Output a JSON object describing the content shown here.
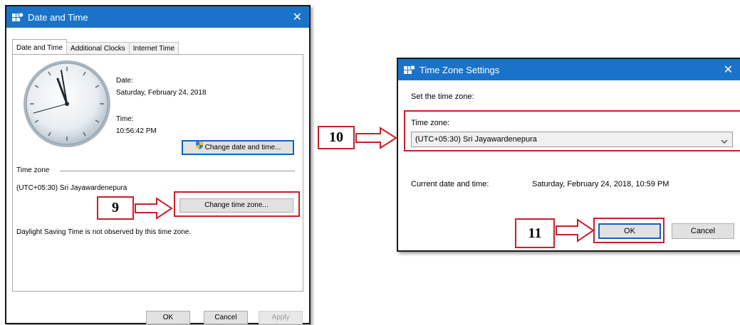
{
  "dt_window": {
    "title": "Date and Time",
    "close_glyph": "✕",
    "tabs": [
      {
        "label": "Date and Time",
        "active": true
      },
      {
        "label": "Additional Clocks",
        "active": false
      },
      {
        "label": "Internet Time",
        "active": false
      }
    ],
    "date_label": "Date:",
    "date_value": "Saturday, February 24, 2018",
    "time_label": "Time:",
    "time_value": "10:56:42 PM",
    "change_datetime_button": "Change date and time...",
    "timezone_section_label": "Time zone",
    "timezone_value": "(UTC+05:30) Sri Jayawardenepura",
    "change_timezone_button": "Change time zone...",
    "dst_note": "Daylight Saving Time is not observed by this time zone.",
    "ok_button": "OK",
    "cancel_button": "Cancel",
    "apply_button": "Apply"
  },
  "tz_window": {
    "title": "Time Zone Settings",
    "close_glyph": "✕",
    "instruction": "Set the time zone:",
    "timezone_label": "Time zone:",
    "timezone_selected": "(UTC+05:30) Sri Jayawardenepura",
    "current_label": "Current date and time:",
    "current_value": "Saturday, February 24, 2018, 10:59 PM",
    "ok_button": "OK",
    "cancel_button": "Cancel"
  },
  "steps": {
    "step9": "9",
    "step10": "10",
    "step11": "11"
  },
  "colors": {
    "titlebar": "#1a73c9",
    "highlight": "#c8202a"
  },
  "icons": [
    "clock-icon",
    "window-app-icon",
    "shield-icon",
    "chevron-down-icon",
    "close-icon",
    "arrow-right-icon"
  ]
}
